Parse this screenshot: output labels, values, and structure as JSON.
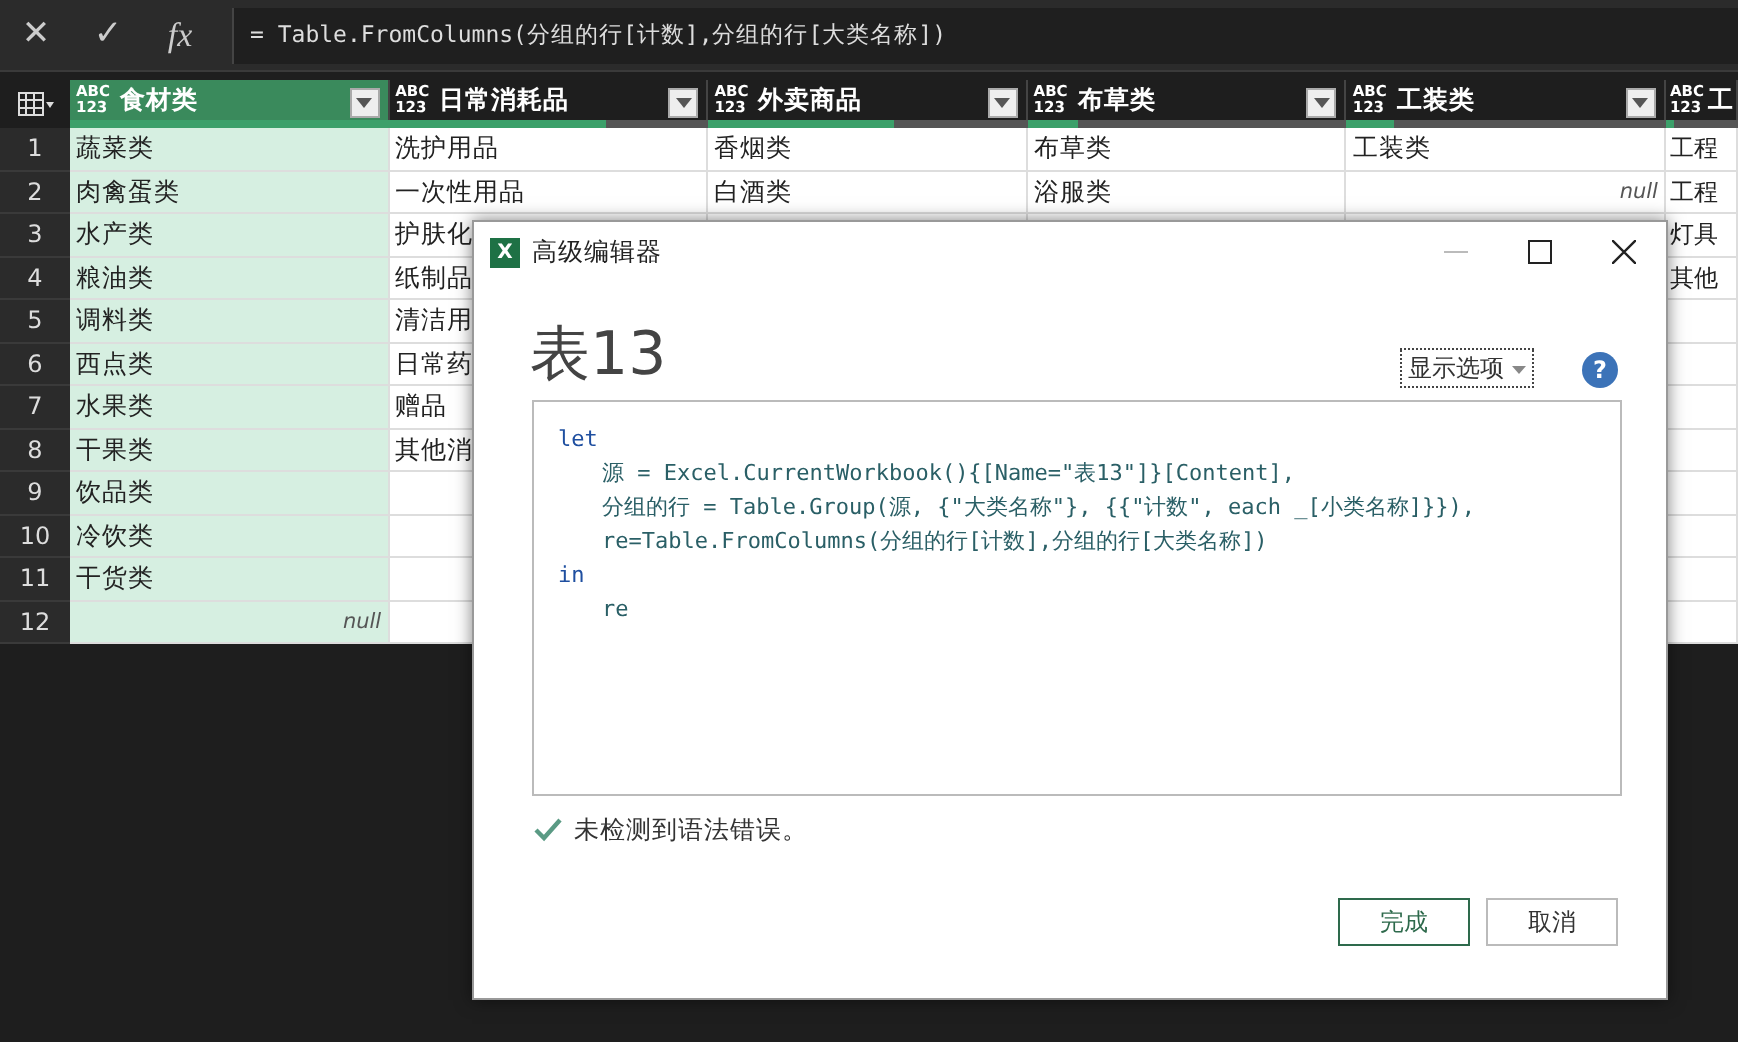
{
  "formula_bar": {
    "cancel": "✕",
    "confirm": "✓",
    "fx": "fx",
    "formula": "= Table.FromColumns(分组的行[计数],分组的行[大类名称])"
  },
  "table": {
    "columns": [
      {
        "type": "ABC\n123",
        "name": "食材类",
        "selected": true,
        "level": 1
      },
      {
        "type": "ABC\n123",
        "name": "日常消耗品",
        "selected": false,
        "level": 0.68
      },
      {
        "type": "ABC\n123",
        "name": "外卖商品",
        "selected": false,
        "level": 0.58
      },
      {
        "type": "ABC\n123",
        "name": "布草类",
        "selected": false,
        "level": 0.16
      },
      {
        "type": "ABC\n123",
        "name": "工装类",
        "selected": false,
        "level": 0.15
      },
      {
        "type": "ABC\n123",
        "name": "工",
        "selected": false,
        "level": 0.1
      }
    ],
    "rows": [
      {
        "number": "1",
        "cells": [
          "蔬菜类",
          "洗护用品",
          "香烟类",
          "布草类",
          "工装类",
          "工程"
        ]
      },
      {
        "number": "2",
        "cells": [
          "肉禽蛋类",
          "一次性用品",
          "白酒类",
          "浴服类",
          {
            "text": "null",
            "kind": "null"
          },
          "工程"
        ]
      },
      {
        "number": "3",
        "cells": [
          "水产类",
          "护肤化",
          null,
          null,
          null,
          "灯具"
        ]
      },
      {
        "number": "4",
        "cells": [
          "粮油类",
          "纸制品",
          null,
          null,
          null,
          "其他"
        ]
      },
      {
        "number": "5",
        "cells": [
          "调料类",
          "清洁用"
        ]
      },
      {
        "number": "6",
        "cells": [
          "西点类",
          "日常药"
        ]
      },
      {
        "number": "7",
        "cells": [
          "水果类",
          "赠品"
        ]
      },
      {
        "number": "8",
        "cells": [
          "干果类",
          "其他消"
        ]
      },
      {
        "number": "9",
        "cells": [
          "饮品类"
        ]
      },
      {
        "number": "10",
        "cells": [
          "冷饮类"
        ]
      },
      {
        "number": "11",
        "cells": [
          "干货类"
        ]
      },
      {
        "number": "12",
        "cells": [
          {
            "text": "null",
            "kind": "null"
          }
        ]
      }
    ]
  },
  "dialog": {
    "app_icon": "X",
    "title": "高级编辑器",
    "query_name": "表13",
    "options": "显示选项",
    "help": "?",
    "code": [
      {
        "kind": "keyword",
        "text": "let"
      },
      {
        "kind": "statement",
        "text": "源 = Excel.CurrentWorkbook(){[Name=\"表13\"]}[Content],"
      },
      {
        "kind": "statement",
        "text": "分组的行 = Table.Group(源, {\"大类名称\"}, {{\"计数\", each _[小类名称]}}),"
      },
      {
        "kind": "statement",
        "text": "re=Table.FromColumns(分组的行[计数],分组的行[大类名称])"
      },
      {
        "kind": "keyword",
        "text": "in"
      },
      {
        "kind": "statement",
        "text": "re"
      }
    ],
    "status": "未检测到语法错误。",
    "buttons": [
      {
        "label": "完成",
        "primary": true
      },
      {
        "label": "取消",
        "primary": false
      }
    ]
  }
}
